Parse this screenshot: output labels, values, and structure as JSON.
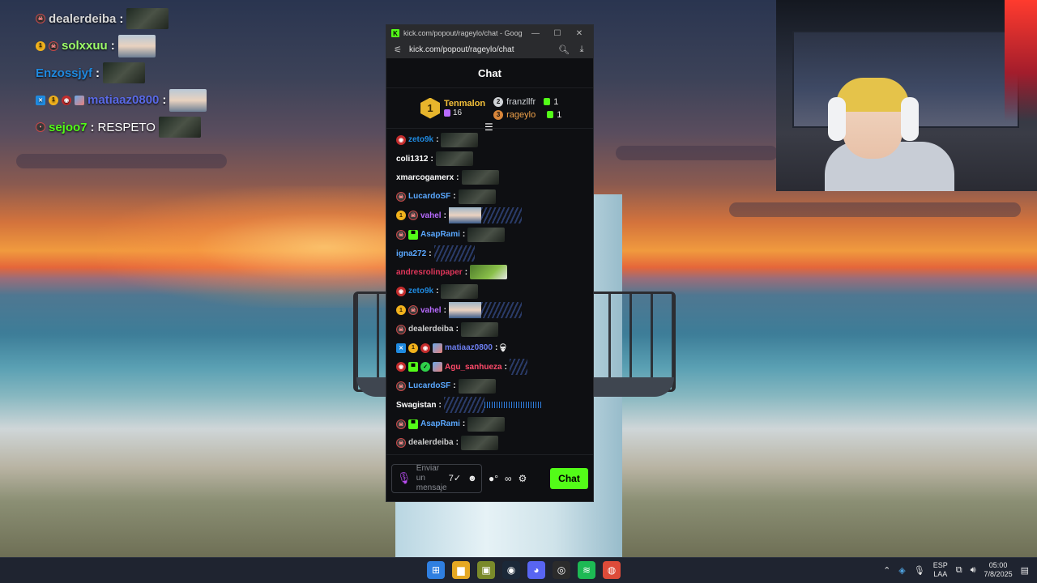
{
  "overlay_chat": [
    {
      "user": "dealerdeiba",
      "color": "#d7d7d7",
      "badges": [
        "skull"
      ],
      "sep": ":",
      "text": "",
      "emote": "emote"
    },
    {
      "user": "solxxuu",
      "color": "#9dff6a",
      "badges": [
        "one",
        "skull"
      ],
      "sep": ":",
      "text": "",
      "emote": "face"
    },
    {
      "user": "Enzossjyf",
      "color": "#1f8ae0",
      "badges": [],
      "sep": ":",
      "text": "",
      "emote": "emote"
    },
    {
      "user": "matiaaz0800",
      "color": "#5a6ae8",
      "badges": [
        "pin",
        "one",
        "red",
        "pic"
      ],
      "sep": ":",
      "text": "",
      "emote": "face"
    },
    {
      "user": "sejoo7",
      "color": "#53fc18",
      "badges": [
        "dot"
      ],
      "sep": ":",
      "text": "RESPETO",
      "emote": "emote"
    }
  ],
  "browser": {
    "tab_title": "kick.com/popout/rageylo/chat - Google...",
    "url": "kick.com/popout/rageylo/chat",
    "min": "—",
    "max": "☐",
    "close": "✕"
  },
  "chat": {
    "title": "Chat",
    "leaderboard": {
      "first": {
        "rank": "1",
        "name": "Tenmalon",
        "count": "16"
      },
      "second": {
        "rank": "2",
        "name": "franzllfr",
        "count": "1"
      },
      "third": {
        "rank": "3",
        "name": "rageylo",
        "count": "1"
      }
    },
    "messages": [
      {
        "user": "zeto9k",
        "color": "#1f8ae0",
        "badges": [
          "red"
        ],
        "emote": "emote"
      },
      {
        "user": "coli1312",
        "color": "#ffffff",
        "badges": [],
        "emote": "emote"
      },
      {
        "user": "xmarcogamerx",
        "color": "#ffffff",
        "badges": [],
        "emote": "emote"
      },
      {
        "user": "LucardoSF",
        "color": "#5aa8ff",
        "badges": [
          "skull"
        ],
        "emote": "emote"
      },
      {
        "user": "vahel",
        "color": "#b86bff",
        "badges": [
          "one",
          "skull"
        ],
        "emote": "face-rain"
      },
      {
        "user": "AsapRami",
        "color": "#5aa8ff",
        "badges": [
          "skull",
          "sub"
        ],
        "emote": "emote"
      },
      {
        "user": "igna272",
        "color": "#5aa8ff",
        "badges": [],
        "emote": "rain"
      },
      {
        "user": "andresrolinpaper",
        "color": "#e0365a",
        "badges": [],
        "emote": "frog"
      },
      {
        "user": "zeto9k",
        "color": "#1f8ae0",
        "badges": [
          "red"
        ],
        "emote": "emote"
      },
      {
        "user": "vahel",
        "color": "#b86bff",
        "badges": [
          "one",
          "skull"
        ],
        "emote": "face-rain"
      },
      {
        "user": "dealerdeiba",
        "color": "#cfcfcf",
        "badges": [
          "skull"
        ],
        "emote": "emote"
      },
      {
        "user": "matiaaz0800",
        "color": "#6d7ef0",
        "badges": [
          "pin",
          "one",
          "red",
          "pic"
        ],
        "emote": "skull"
      },
      {
        "user": "Agu_sanhueza",
        "color": "#ff4a6a",
        "badges": [
          "red",
          "sub",
          "green",
          "pic"
        ],
        "emote": "rain-small"
      },
      {
        "user": "LucardoSF",
        "color": "#5aa8ff",
        "badges": [
          "skull"
        ],
        "emote": "emote"
      },
      {
        "user": "Swagistan",
        "color": "#ffffff",
        "badges": [],
        "emote": "rain-bars"
      },
      {
        "user": "AsapRami",
        "color": "#5aa8ff",
        "badges": [
          "skull",
          "sub"
        ],
        "emote": "emote"
      },
      {
        "user": "dealerdeiba",
        "color": "#cfcfcf",
        "badges": [
          "skull"
        ],
        "emote": "emote"
      }
    ],
    "input_placeholder": "Enviar un mensaje",
    "send_label": "Chat"
  },
  "taskbar": {
    "lang_top": "ESP",
    "lang_bottom": "LAA",
    "time": "05:00",
    "date": "7/8/2025"
  },
  "colors": {
    "kick_green": "#53fc18",
    "gold": "#f4c13a"
  }
}
